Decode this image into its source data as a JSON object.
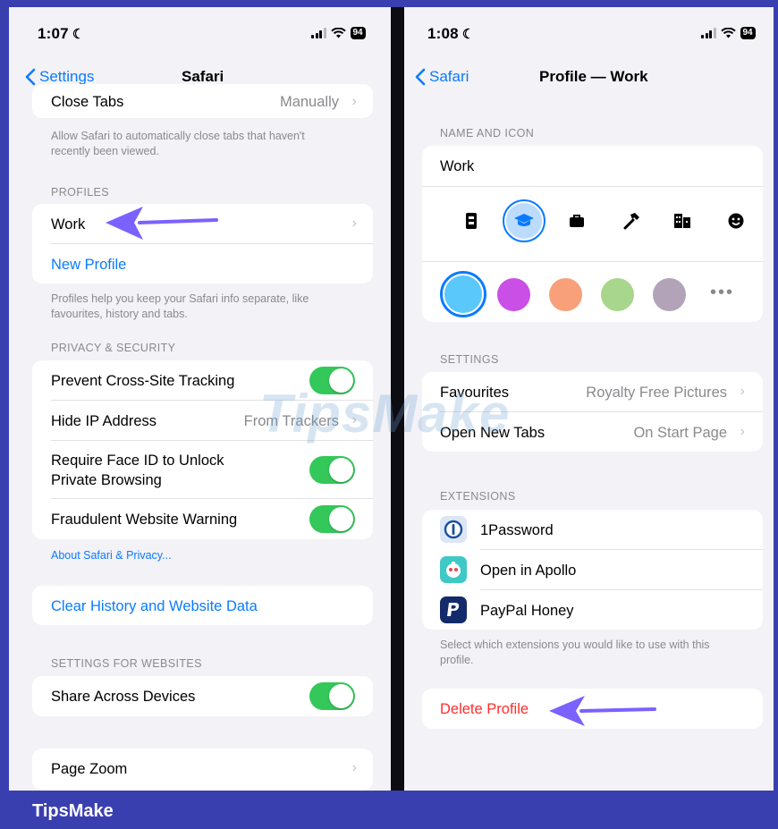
{
  "brand": "TipsMake",
  "watermark": "TipsMake",
  "colors": {
    "accent": "#0a7bff",
    "toggle_on": "#34c759",
    "destructive": "#ff2d2d",
    "arrow": "#7b61ff",
    "frame": "#3a3fb0"
  },
  "left": {
    "status": {
      "time": "1:07",
      "battery": "94"
    },
    "nav": {
      "back_label": "Settings",
      "title": "Safari"
    },
    "close_tabs": {
      "label": "Close Tabs",
      "value": "Manually"
    },
    "close_tabs_footer": "Allow Safari to automatically close tabs that haven't recently been viewed.",
    "profiles": {
      "header": "Profiles",
      "items": [
        "Work",
        "New Profile"
      ],
      "footer": "Profiles help you keep your Safari info separate, like favourites, history and tabs."
    },
    "privacy": {
      "header": "Privacy & Security",
      "prevent_tracking": {
        "label": "Prevent Cross-Site Tracking",
        "on": true
      },
      "hide_ip": {
        "label": "Hide IP Address",
        "value": "From Trackers"
      },
      "face_id": {
        "label_line1": "Require Face ID to Unlock",
        "label_line2": "Private Browsing",
        "on": true
      },
      "fraud_warning": {
        "label": "Fraudulent Website Warning",
        "on": true
      },
      "about_link": "About Safari & Privacy..."
    },
    "clear_history": "Clear History and Website Data",
    "websites": {
      "header": "Settings for Websites",
      "share_devices": {
        "label": "Share Across Devices",
        "on": true
      }
    },
    "page_zoom": "Page Zoom"
  },
  "right": {
    "status": {
      "time": "1:08",
      "battery": "94"
    },
    "nav": {
      "back_label": "Safari",
      "title": "Profile — Work"
    },
    "name_icon": {
      "header": "Name and Icon",
      "name": "Work",
      "icons": [
        "id-badge-icon",
        "graduation-cap-icon",
        "briefcase-icon",
        "hammer-icon",
        "building-icon",
        "smiley-icon"
      ],
      "selected_icon": "graduation-cap-icon",
      "swatches": [
        "#5ac8fa",
        "#c94fe6",
        "#f7a07a",
        "#a8d68c",
        "#b3a3b8"
      ],
      "selected_swatch": 0,
      "more_label": "•••"
    },
    "settings": {
      "header": "Settings",
      "favourites": {
        "label": "Favourites",
        "value": "Royalty Free Pictures"
      },
      "new_tabs": {
        "label": "Open New Tabs",
        "value": "On Start Page"
      }
    },
    "extensions": {
      "header": "Extensions",
      "items": [
        {
          "name": "1Password",
          "icon": "1password-icon"
        },
        {
          "name": "Open in Apollo",
          "icon": "apollo-icon"
        },
        {
          "name": "PayPal Honey",
          "icon": "paypal-honey-icon"
        }
      ],
      "footer": "Select which extensions you would like to use with this profile."
    },
    "delete": "Delete Profile"
  }
}
